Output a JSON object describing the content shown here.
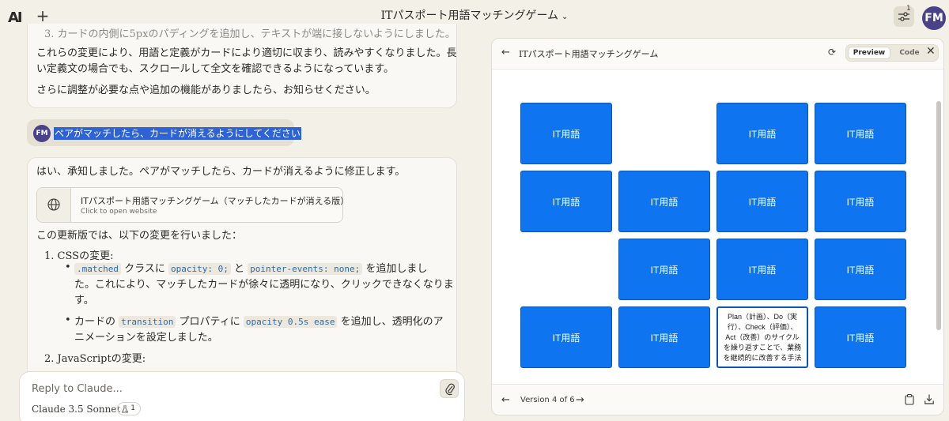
{
  "app": {
    "logo": "AI",
    "title": "ITパスポート用語マッチングゲーム",
    "settings_count": "1",
    "avatar": "FM"
  },
  "chat": {
    "faded_line": "3. カードの内側に5pxのパディングを追加し、テキストが端に接しないようにしました。",
    "para1_line1": "これらの変更により、用語と定義がカードにより適切に収まり、読みやすくなりました。長",
    "para1_line2": "い定義文の場合でも、スクロールして全文を確認できるようになっています。",
    "para2": "さらに調整が必要な点や追加の機能がありましたら、お知らせください。",
    "user_avatar": "FM",
    "user_message": "ペアがマッチしたら、カードが消えるようにしてください",
    "reply_intro": "はい、承知しました。ペアがマッチしたら、カードが消えるように修正します。",
    "artifact_title": "ITパスポート用語マッチングゲーム（マッチしたカードが消える版）",
    "artifact_sub": "Click to open website",
    "changes_intro": "この更新版では、以下の変更を行いました：",
    "section1": "1. CSSの変更:",
    "b1_code1": ".matched",
    "b1_t1": " クラスに ",
    "b1_code2": "opacity: 0;",
    "b1_t2": " と ",
    "b1_code3": "pointer-events: none;",
    "b1_t3": " を追加しまし",
    "b1_line2": "た。これにより、マッチしたカードが徐々に透明になり、クリックできなくなりま",
    "b1_line3": "す。",
    "b2_t1": "カードの ",
    "b2_code1": "transition",
    "b2_t2": " プロパティに ",
    "b2_code2": "opacity 0.5s ease",
    "b2_t3": " を追加し、透明化のア",
    "b2_line2": "ニメーションを設定しました。",
    "section2": "2. JavaScriptの変更:",
    "reply_placeholder": "Reply to Claude...",
    "model_name": "Claude 3.5 Sonnet",
    "pill_count": "1"
  },
  "panel": {
    "title": "ITパスポート用語マッチングゲーム",
    "tab_preview": "Preview",
    "tab_code": "Code",
    "version": "Version 4 of 6"
  },
  "game": {
    "cards": [
      {
        "text": "IT用語",
        "visible": true,
        "flipped": false
      },
      {
        "text": "",
        "visible": false,
        "flipped": false
      },
      {
        "text": "IT用語",
        "visible": true,
        "flipped": false
      },
      {
        "text": "IT用語",
        "visible": true,
        "flipped": false
      },
      {
        "text": "IT用語",
        "visible": true,
        "flipped": false
      },
      {
        "text": "IT用語",
        "visible": true,
        "flipped": false
      },
      {
        "text": "IT用語",
        "visible": true,
        "flipped": false
      },
      {
        "text": "IT用語",
        "visible": true,
        "flipped": false
      },
      {
        "text": "",
        "visible": false,
        "flipped": false
      },
      {
        "text": "IT用語",
        "visible": true,
        "flipped": false
      },
      {
        "text": "IT用語",
        "visible": true,
        "flipped": false
      },
      {
        "text": "IT用語",
        "visible": true,
        "flipped": false
      },
      {
        "text": "IT用語",
        "visible": true,
        "flipped": false
      },
      {
        "text": "IT用語",
        "visible": true,
        "flipped": false
      },
      {
        "text": "Plan（計画）、Do（実行）、Check（評価）、Act（改善）のサイクルを繰り返すことで、業務を継続的に改善する手法",
        "visible": true,
        "flipped": true
      },
      {
        "text": "IT用語",
        "visible": true,
        "flipped": false
      }
    ]
  },
  "colors": {
    "card_blue": "#0f74ef",
    "highlight": "#2d63d6",
    "avatar": "#4a4289"
  }
}
